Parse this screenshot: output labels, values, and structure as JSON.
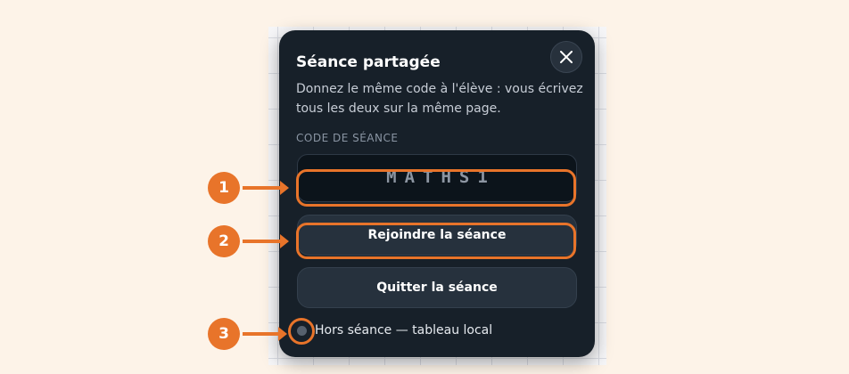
{
  "dialog": {
    "title": "Séance partagée",
    "description": "Donnez le même code à l'élève : vous écrivez tous les deux sur la même page.",
    "code_label": "CODE DE SÉANCE",
    "code_value": "MATHS1",
    "join_label": "Rejoindre la séance",
    "quit_label": "Quitter la séance",
    "status_text": "Hors séance — tableau local",
    "close_icon": "close-icon"
  },
  "annotations": {
    "markers": [
      "1",
      "2",
      "3"
    ],
    "accent_color": "#e8742a"
  },
  "colors": {
    "page_background": "#fdf3e8",
    "panel_background": "#172029",
    "status_dot": "#56616e"
  }
}
